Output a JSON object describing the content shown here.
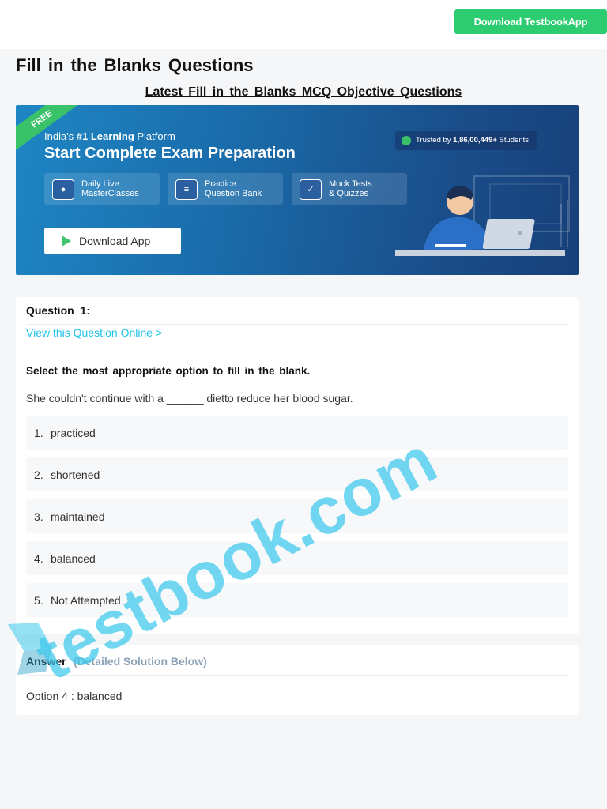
{
  "header": {
    "download_button": "Download TestbookApp"
  },
  "page": {
    "title": "Fill in the Blanks Questions",
    "subtitle": "Latest Fill in the Blanks MCQ Objective Questions"
  },
  "banner": {
    "ribbon": "FREE",
    "tagline_prefix": "India's ",
    "tagline_bold": "#1 Learning",
    "tagline_suffix": " Platform",
    "heading": "Start Complete Exam Preparation",
    "trust_prefix": "Trusted by ",
    "trust_bold": "1,86,00,449+",
    "trust_suffix": " Students",
    "features": [
      {
        "line1": "Daily Live",
        "line2": "MasterClasses",
        "icon": "video-class-icon"
      },
      {
        "line1": "Practice",
        "line2": "Question Bank",
        "icon": "question-bank-icon"
      },
      {
        "line1": "Mock Tests",
        "line2": "& Quizzes",
        "icon": "mock-test-icon"
      }
    ],
    "app_button": "Download App",
    "accent_color": "#39c26a"
  },
  "question": {
    "label": "Question 1:",
    "view_link": "View this Question Online >",
    "instruction": "Select the most appropriate option to fill in the blank.",
    "sentence": "She couldn't continue with a ______ dietto reduce her blood sugar.",
    "options": [
      {
        "num": "1.",
        "text": "practiced"
      },
      {
        "num": "2.",
        "text": "shortened"
      },
      {
        "num": "3.",
        "text": "maintained"
      },
      {
        "num": "4.",
        "text": "balanced"
      },
      {
        "num": "5.",
        "text": "Not Attempted"
      }
    ]
  },
  "answer": {
    "label": "Answer",
    "sub": "(Detailed Solution Below)",
    "text": "Option 4 : balanced"
  },
  "watermark": {
    "text": "testbook.com"
  }
}
